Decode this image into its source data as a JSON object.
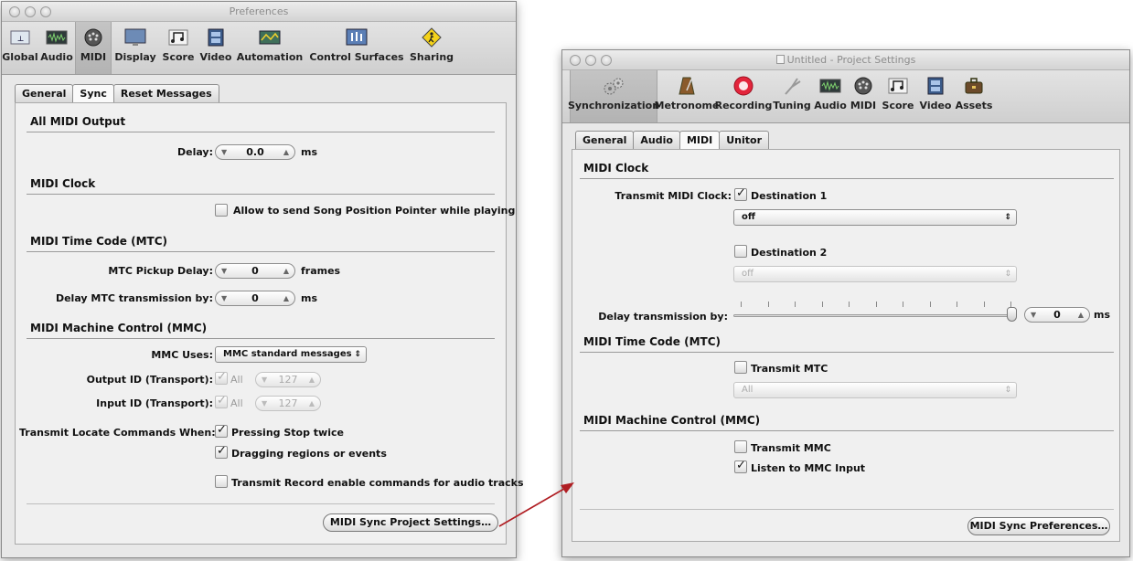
{
  "pref": {
    "window_title": "Preferences",
    "toolbar": [
      "Global",
      "Audio",
      "MIDI",
      "Display",
      "Score",
      "Video",
      "Automation",
      "Control Surfaces",
      "Sharing"
    ],
    "tabs": [
      "General",
      "Sync",
      "Reset Messages"
    ],
    "sec_output": "All MIDI Output",
    "delay_label": "Delay:",
    "delay_value": "0.0",
    "ms": "ms",
    "sec_clock": "MIDI Clock",
    "spp_label": "Allow to send Song Position Pointer while playing",
    "sec_mtc": "MIDI Time Code (MTC)",
    "pickup_label": "MTC Pickup Delay:",
    "pickup_value": "0",
    "frames": "frames",
    "delay_mtc_label": "Delay MTC transmission by:",
    "delay_mtc_value": "0",
    "sec_mmc": "MIDI Machine Control (MMC)",
    "mmc_uses_label": "MMC Uses:",
    "mmc_uses_value": "MMC standard messages",
    "output_id_label": "Output ID (Transport):",
    "input_id_label": "Input ID (Transport):",
    "all": "All",
    "id_value": "127",
    "locate_label": "Transmit Locate Commands When:",
    "pressing_stop": "Pressing Stop twice",
    "dragging": "Dragging regions or events",
    "record_enable": "Transmit Record enable commands for audio tracks",
    "button": "MIDI Sync Project Settings…"
  },
  "proj": {
    "window_title": "Untitled - Project Settings",
    "toolbar": [
      "Synchronization",
      "Metronome",
      "Recording",
      "Tuning",
      "Audio",
      "MIDI",
      "Score",
      "Video",
      "Assets"
    ],
    "tabs": [
      "General",
      "Audio",
      "MIDI",
      "Unitor"
    ],
    "sec_clock": "MIDI Clock",
    "transmit_clock_label": "Transmit MIDI Clock:",
    "dest1": "Destination 1",
    "dest1_value": "off",
    "dest2": "Destination 2",
    "dest2_value": "off",
    "delay_tx_label": "Delay transmission by:",
    "delay_tx_value": "0",
    "ms": "ms",
    "sec_mtc": "MIDI Time Code (MTC)",
    "transmit_mtc": "Transmit MTC",
    "mtc_value": "All",
    "sec_mmc": "MIDI Machine Control (MMC)",
    "transmit_mmc": "Transmit MMC",
    "listen_mmc": "Listen to MMC Input",
    "button": "MIDI Sync Preferences…"
  },
  "colors": {
    "arrow": "#b01e23",
    "record": "#e3253c"
  }
}
